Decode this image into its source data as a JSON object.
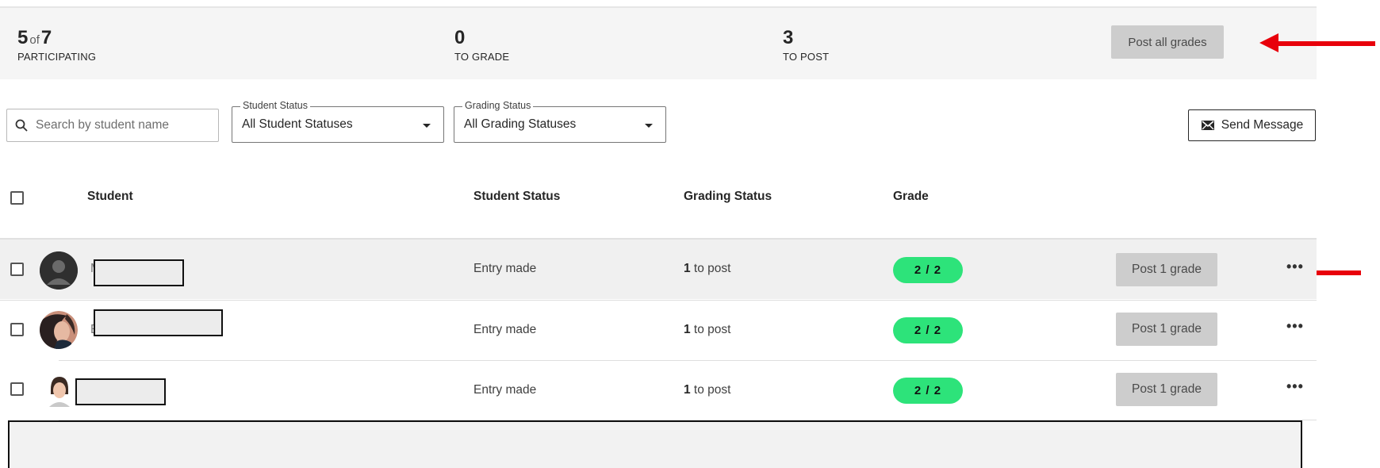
{
  "summary": {
    "participating": {
      "count": "5",
      "of_word": "of",
      "total": "7",
      "label": "PARTICIPATING"
    },
    "to_grade": {
      "count": "0",
      "label": "TO GRADE"
    },
    "to_post": {
      "count": "3",
      "label": "TO POST"
    },
    "post_all_label": "Post all grades"
  },
  "filters": {
    "search_placeholder": "Search by student name",
    "student_status": {
      "legend": "Student Status",
      "value": "All Student Statuses"
    },
    "grading_status": {
      "legend": "Grading Status",
      "value": "All Grading Statuses"
    },
    "send_message_label": "Send Message"
  },
  "table": {
    "headers": {
      "student": "Student",
      "student_status": "Student Status",
      "grading_status": "Grading Status",
      "grade": "Grade"
    },
    "rows": [
      {
        "name_visible": "M",
        "student_status": "Entry made",
        "grading_count": "1",
        "grading_suffix": " to post",
        "grade": "2 / 2",
        "post_label": "Post 1 grade",
        "more": "•••",
        "avatar": "default-avatar"
      },
      {
        "name_visible": "E",
        "student_status": "Entry made",
        "grading_count": "1",
        "grading_suffix": " to post",
        "grade": "2 / 2",
        "post_label": "Post 1 grade",
        "more": "•••",
        "avatar": "photo-avatar"
      },
      {
        "name_visible": "",
        "student_status": "Entry made",
        "grading_count": "1",
        "grading_suffix": " to post",
        "grade": "2 / 2",
        "post_label": "Post 1 grade",
        "more": "•••",
        "avatar": "photo-avatar"
      }
    ]
  },
  "colors": {
    "accent_arrow": "#e8000b",
    "grade_pill": "#2de37a",
    "button_gray": "#cdcdcd"
  }
}
